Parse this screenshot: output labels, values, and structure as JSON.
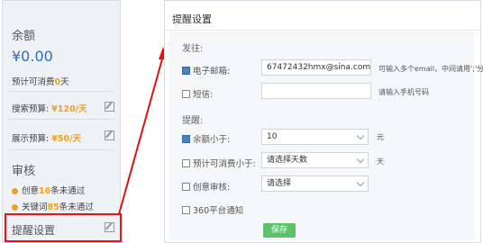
{
  "sidebar": {
    "balance_title": "余额",
    "balance_value": "¥0.00",
    "forecast_prefix": "预计可消费",
    "forecast_value": "0",
    "forecast_suffix": "天",
    "search_budget_label": "搜索预算:",
    "search_budget_value": "¥120/天",
    "display_budget_label": "展示预算:",
    "display_budget_value": "¥50/天",
    "review_title": "审核",
    "review_items": [
      {
        "prefix": "创意",
        "count": "16",
        "suffix": "条未通过"
      },
      {
        "prefix": "关键词",
        "count": "85",
        "suffix": "条未通过"
      }
    ],
    "remind_title": "提醒设置"
  },
  "main": {
    "title": "提醒设置",
    "send_section": "发往:",
    "email_label": "电子邮箱:",
    "email_value": "67472432hmx@sina.com",
    "email_hint": "可输入多个email，中间请用';'分隔",
    "sms_label": "短信:",
    "sms_value": "",
    "sms_hint": "请输入手机号码",
    "remind_section": "提醒:",
    "balance_below_label": "余额小于:",
    "balance_below_value": "10",
    "balance_unit": "元",
    "forecast_below_label": "预计可消费小于:",
    "forecast_below_value": "请选择天数",
    "forecast_unit": "天",
    "creative_review_label": "创意审核:",
    "creative_review_value": "请选择",
    "platform_notice_label": "360平台通知",
    "save_label": "保存"
  },
  "colors": {
    "accent": "#2d6cc3",
    "highlight": "#f0a020",
    "annotation": "#e11111",
    "save": "#5cc36a"
  }
}
